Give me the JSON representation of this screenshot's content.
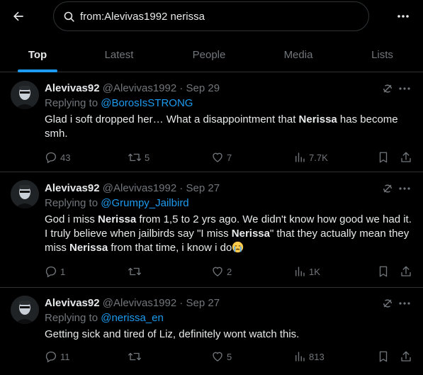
{
  "search": {
    "query": "from:Alevivas1992 nerissa"
  },
  "tabs": [
    "Top",
    "Latest",
    "People",
    "Media",
    "Lists"
  ],
  "colors": {
    "accent": "#1d9bf0",
    "background": "#000000",
    "muted": "#71767b",
    "text": "#e7e9ea",
    "divider": "#2f3336"
  },
  "tweets": [
    {
      "name": "Alevivas92",
      "handle": "@Alevivas1992",
      "dot": "·",
      "date": "Sep 29",
      "replying_prefix": "Replying to",
      "replying_to": "@BorosIsSTRONG",
      "text_parts": [
        "Glad i soft dropped her… What a disappointment that ",
        "Nerissa",
        " has become smh."
      ],
      "stats": {
        "replies": "43",
        "retweets": "5",
        "likes": "7",
        "views": "7.7K"
      }
    },
    {
      "name": "Alevivas92",
      "handle": "@Alevivas1992",
      "dot": "·",
      "date": "Sep 27",
      "replying_prefix": "Replying to",
      "replying_to": "@Grumpy_Jailbird",
      "text_parts": [
        "God i miss ",
        "Nerissa",
        " from 1,5 to 2 yrs ago. We didn't know how good we had it. I truly believe when jailbirds say \"I miss ",
        "Nerissa",
        "\" that they actually mean they miss ",
        "Nerissa",
        " from that time, i know i do"
      ],
      "emoji": "crying-face",
      "stats": {
        "replies": "1",
        "retweets": "",
        "likes": "2",
        "views": "1K"
      }
    },
    {
      "name": "Alevivas92",
      "handle": "@Alevivas1992",
      "dot": "·",
      "date": "Sep 27",
      "replying_prefix": "Replying to",
      "replying_to": "@nerissa_en",
      "text_parts": [
        "Getting sick and tired of Liz, definitely wont watch this."
      ],
      "stats": {
        "replies": "11",
        "retweets": "",
        "likes": "5",
        "views": "813"
      }
    }
  ]
}
